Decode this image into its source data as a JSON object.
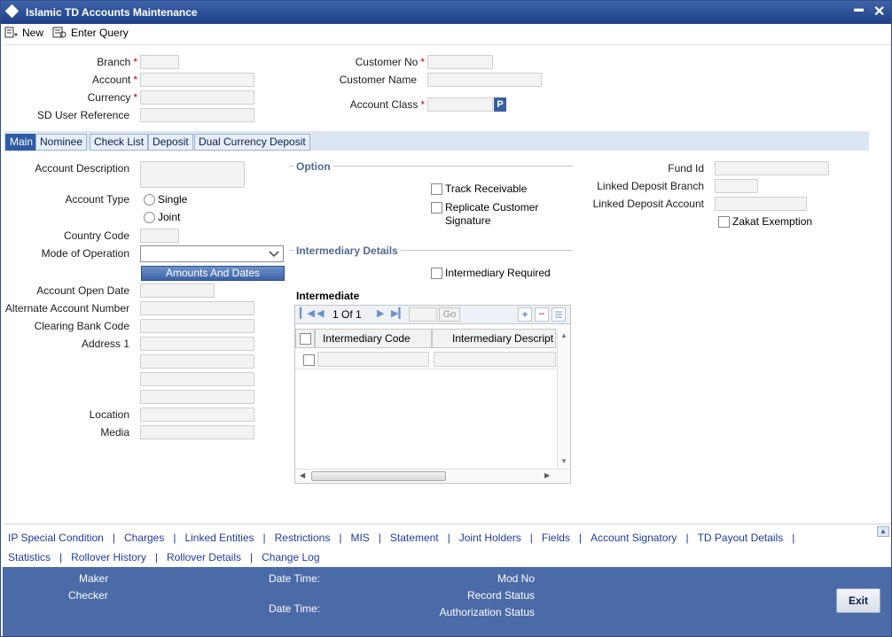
{
  "window": {
    "title": "Islamic TD Accounts Maintenance",
    "minimize": "▬",
    "close": "✕"
  },
  "toolbar": {
    "new_label": "New",
    "enter_query_label": "Enter Query"
  },
  "header": {
    "branch_label": "Branch",
    "account_label": "Account",
    "currency_label": "Currency",
    "sd_user_ref_label": "SD User Reference",
    "customer_no_label": "Customer No",
    "customer_name_label": "Customer Name",
    "account_class_label": "Account Class",
    "lov_button": "P",
    "required_mark": "*"
  },
  "tabs": [
    {
      "label": "Main",
      "active": true
    },
    {
      "label": "Nominee"
    },
    {
      "label": "Check List"
    },
    {
      "label": "Deposit"
    },
    {
      "label": "Dual Currency Deposit"
    }
  ],
  "main": {
    "account_description_label": "Account Description",
    "account_type_label": "Account Type",
    "account_type_options": [
      "Single",
      "Joint"
    ],
    "country_code_label": "Country Code",
    "mode_of_operation_label": "Mode of Operation",
    "amounts_and_dates_button": "Amounts And Dates",
    "account_open_date_label": "Account Open Date",
    "alternate_account_number_label": "Alternate Account Number",
    "clearing_bank_code_label": "Clearing Bank Code",
    "address1_label": "Address 1",
    "location_label": "Location",
    "media_label": "Media",
    "option_title": "Option",
    "track_receivable_label": "Track Receivable",
    "replicate_signature_label_1": "Replicate Customer",
    "replicate_signature_label_2": "Signature",
    "intermediary_details_title": "Intermediary Details",
    "intermediary_required_label": "Intermediary Required",
    "fund_id_label": "Fund Id",
    "linked_deposit_branch_label": "Linked Deposit Branch",
    "linked_deposit_account_label": "Linked Deposit Account",
    "zakat_exemption_label": "Zakat Exemption"
  },
  "intermediate": {
    "title": "Intermediate",
    "pager": "1 Of 1",
    "go_label": "Go",
    "columns": [
      "Intermediary Code",
      "Intermediary Descript"
    ]
  },
  "footer_links": {
    "row1": [
      "IP Special Condition",
      "Charges",
      "Linked Entities",
      "Restrictions",
      "MIS",
      "Statement",
      "Joint Holders",
      "Fields",
      "Account Signatory",
      "TD Payout Details"
    ],
    "row2": [
      "Statistics",
      "Rollover History",
      "Rollover Details",
      "Change Log"
    ],
    "separator": "|"
  },
  "audit": {
    "maker_label": "Maker",
    "checker_label": "Checker",
    "date_time_label": "Date Time:",
    "mod_no_label": "Mod No",
    "record_status_label": "Record Status",
    "authorization_status_label": "Authorization Status",
    "exit_label": "Exit"
  }
}
